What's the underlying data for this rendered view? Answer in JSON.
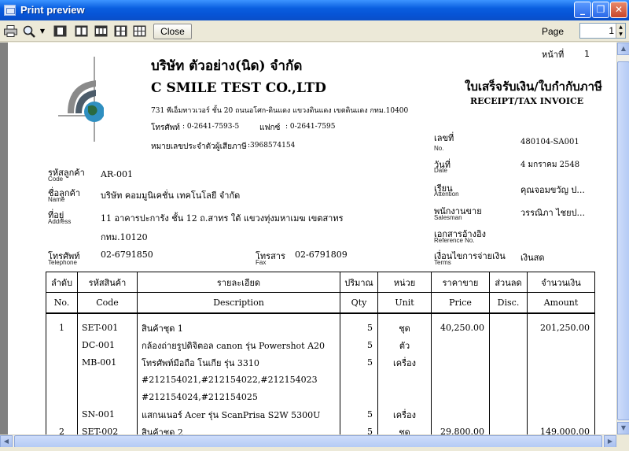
{
  "window": {
    "title": "Print preview"
  },
  "toolbar": {
    "close_label": "Close",
    "page_label": "Page",
    "page_value": "1"
  },
  "document": {
    "page_no_label": "หน้าที่",
    "page_no": "1",
    "company_th": "บริษัท ตัวอย่าง(นิด) จำกัด",
    "company_en": "C SMILE TEST CO.,LTD",
    "address": "731 พีเอ็มทาวเวอร์ ชั้น 20 ถนนอโศก-ดินแดง แขวงดินแดง เขตดินแดง กทม.10400",
    "phone_label": "โทรศัพท์",
    "phone": ": 0-2641-7593-5",
    "fax_label": "แฟกซ์",
    "fax": ": 0-2641-7595",
    "tax_id_label": "หมายเลขประจำตัวผู้เสียภาษี",
    "tax_id": ":3968574154",
    "doc_title_th": "ใบเสร็จรับเงิน/ใบกำกับภาษี",
    "doc_title_en": "RECEIPT/TAX INVOICE",
    "customer": {
      "code_label": "รหัสลูกค้า",
      "code_sub": "Code",
      "code": "AR-001",
      "name_label": "ชื่อลูกค้า",
      "name_sub": "Name",
      "name": "บริษัท คอมมูนิเคชั่น เทคโนโลยี จำกัด",
      "address_label": "ที่อยู่",
      "address_sub": "Address",
      "address1": "11 อาคารปะการัง ชั้น 12 ถ.สาทร ใต้ แขวงทุ่งมหาเมฆ เขตสาทร",
      "address2": "กทม.10120",
      "tel_label": "โทรศัพท์",
      "tel_sub": "Telephone",
      "tel": "02-6791850",
      "fax_label": "โทรสาร",
      "fax_sub": "Fax",
      "fax": "02-6791809"
    },
    "meta": {
      "no_label": "เลขที่",
      "no_sub": "No.",
      "no": "480104-SA001",
      "date_label": "วันที่",
      "date_sub": "Date",
      "date": "4 มกราคม 2548",
      "attn_label": "เรียน",
      "attn_sub": "Attention",
      "attn": "คุณจอมขวัญ ป...",
      "sales_label": "พนักงานขาย",
      "sales_sub": "Salesman",
      "sales": "วรรณิภา ไชยป...",
      "ref_label": "เอกสารอ้างอิง",
      "ref_sub": "Reference No.",
      "ref": "",
      "terms_label": "เงื่อนไขการจ่ายเงิน",
      "terms_sub": "Terms",
      "terms": "เงินสด"
    },
    "table": {
      "headers_th": [
        "ลำดับ",
        "รหัสสินค้า",
        "รายละเอียด",
        "ปริมาณ",
        "หน่วย",
        "ราคาขาย",
        "ส่วนลด",
        "จำนวนเงิน"
      ],
      "headers_en": [
        "No.",
        "Code",
        "Description",
        "Qty",
        "Unit",
        "Price",
        "Disc.",
        "Amount"
      ],
      "rows": [
        {
          "no": "1",
          "code": "SET-001",
          "desc": "สินค้าชุด 1",
          "qty": "5",
          "unit": "ชุด",
          "price": "40,250.00",
          "disc": "",
          "amount": "201,250.00"
        },
        {
          "no": "",
          "code": "DC-001",
          "desc": "กล้องถ่ายรูปดิจิตอล canon รุ่น Powershot A20",
          "qty": "5",
          "unit": "ตัว",
          "price": "",
          "disc": "",
          "amount": ""
        },
        {
          "no": "",
          "code": "MB-001",
          "desc": "โทรศัพท์มือถือ โนเกีย รุ่น 3310",
          "qty": "5",
          "unit": "เครื่อง",
          "price": "",
          "disc": "",
          "amount": ""
        },
        {
          "no": "",
          "code": "",
          "desc": "#212154021,#212154022,#212154023",
          "qty": "",
          "unit": "",
          "price": "",
          "disc": "",
          "amount": ""
        },
        {
          "no": "",
          "code": "",
          "desc": "#212154024,#212154025",
          "qty": "",
          "unit": "",
          "price": "",
          "disc": "",
          "amount": ""
        },
        {
          "no": "",
          "code": "SN-001",
          "desc": "แสกนเนอร์ Acer รุ่น ScanPrisa S2W 5300U",
          "qty": "5",
          "unit": "เครื่อง",
          "price": "",
          "disc": "",
          "amount": ""
        },
        {
          "no": "2",
          "code": "SET-002",
          "desc": "สินค้าชุด 2",
          "qty": "5",
          "unit": "ชุด",
          "price": "29,800.00",
          "disc": "",
          "amount": "149,000.00"
        }
      ]
    }
  }
}
